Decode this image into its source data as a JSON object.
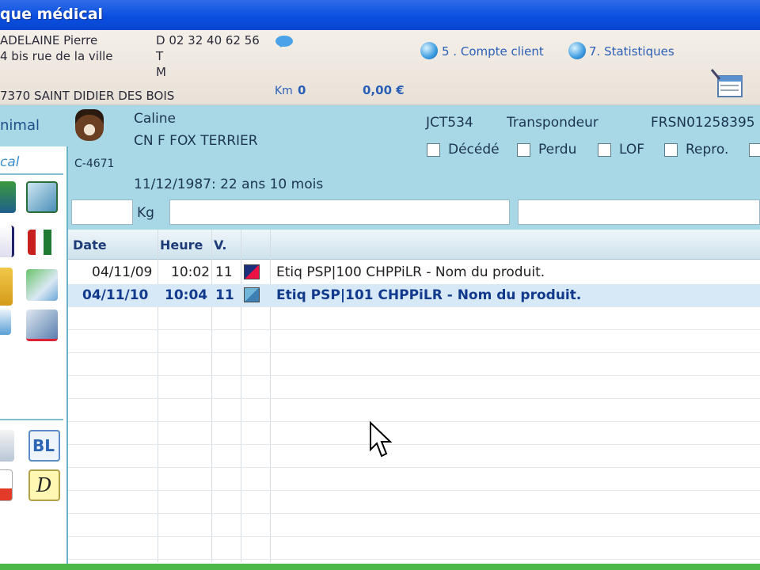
{
  "window": {
    "title": "que médical"
  },
  "client": {
    "name": "ADELAINE Pierre",
    "address": "4 bis rue de la ville",
    "city": "7370 SAINT DIDIER DES BOIS",
    "phone_d": "D 02 32 40 62 56",
    "phone_t": "T",
    "phone_m": "M",
    "km_label": "Km",
    "km_value": "0",
    "balance": "0,00 €",
    "links": [
      {
        "label": "5 . Compte client",
        "icon": "globe-icon"
      },
      {
        "label": "7. Statistiques",
        "icon": "globe-icon"
      }
    ]
  },
  "sidebar": {
    "tab_animal": "nimal",
    "tab_medical": "cal"
  },
  "animal": {
    "name": "Caline",
    "breed": "CN F FOX TERRIER",
    "code": "C-4671",
    "birth": "11/12/1987: 22 ans 10 mois",
    "id_code": "JCT534",
    "id_type": "Transpondeur",
    "id_number": "FRSN01258395",
    "checkboxes": [
      "Décédé",
      "Perdu",
      "LOF",
      "Repro."
    ],
    "weight_unit": "Kg"
  },
  "table": {
    "headers": [
      "Date",
      "Heure",
      "V.",
      ""
    ],
    "rows": [
      {
        "date": "04/11/09",
        "time": "10:02",
        "v": "11",
        "label": "Etiq PSP|100 CHPPiLR - Nom du produit.",
        "selected": false
      },
      {
        "date": "04/11/10",
        "time": "10:04",
        "v": "11",
        "label": "Etiq PSP|101 CHPPiLR - Nom du produit.",
        "selected": true
      }
    ]
  },
  "colors": {
    "titlebar": "#0a4fe0",
    "panel": "#a8d8e6",
    "selection": "#d7e8f6"
  }
}
